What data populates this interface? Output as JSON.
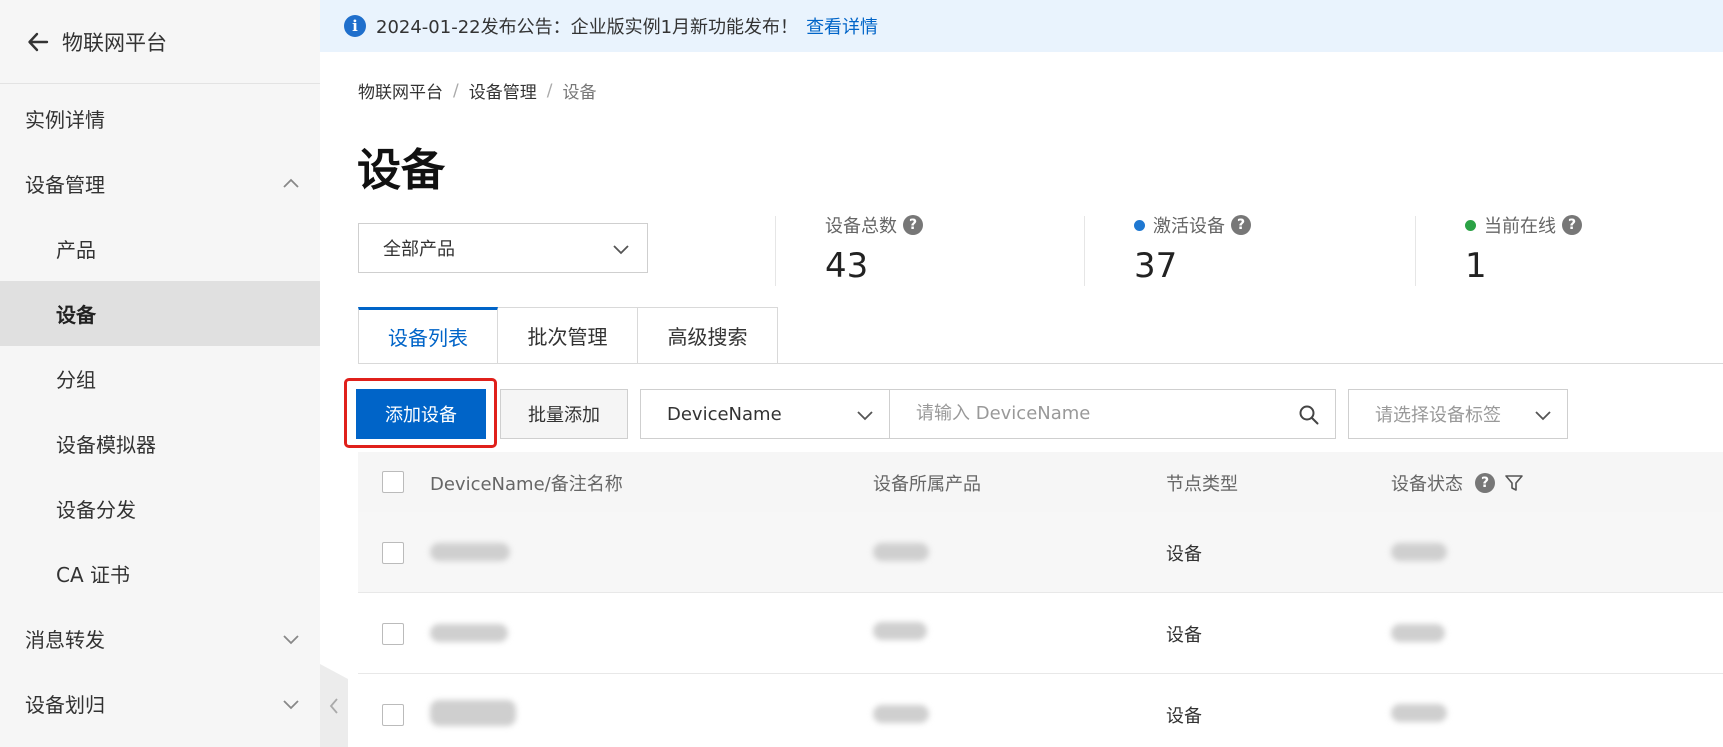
{
  "sidebar": {
    "title": "物联网平台",
    "items": [
      {
        "label": "实例详情"
      },
      {
        "label": "设备管理"
      },
      {
        "label": "产品"
      },
      {
        "label": "设备"
      },
      {
        "label": "分组"
      },
      {
        "label": "设备模拟器"
      },
      {
        "label": "设备分发"
      },
      {
        "label": "CA 证书"
      },
      {
        "label": "消息转发"
      },
      {
        "label": "设备划归"
      }
    ]
  },
  "notice": {
    "text": "2024-01-22发布公告：企业版实例1月新功能发布！",
    "link": "查看详情"
  },
  "breadcrumb": [
    "物联网平台",
    "设备管理",
    "设备"
  ],
  "page_title": "设备",
  "product_select": {
    "value": "全部产品"
  },
  "stats": {
    "total": {
      "label": "设备总数",
      "value": "43"
    },
    "active": {
      "label": "激活设备",
      "value": "37",
      "dot_color": "#1f78d1"
    },
    "online": {
      "label": "当前在线",
      "value": "1",
      "dot_color": "#2ba245"
    }
  },
  "tabs": [
    "设备列表",
    "批次管理",
    "高级搜索"
  ],
  "toolbar": {
    "add_label": "添加设备",
    "batch_label": "批量添加",
    "field_value": "DeviceName",
    "search_placeholder": "请输入 DeviceName",
    "tag_placeholder": "请选择设备标签"
  },
  "table": {
    "headers": [
      "DeviceName/备注名称",
      "设备所属产品",
      "节点类型",
      "设备状态"
    ],
    "rows": [
      {
        "node_type": "设备"
      },
      {
        "node_type": "设备"
      },
      {
        "node_type": "设备"
      }
    ]
  },
  "colors": {
    "accent": "#0064c8",
    "highlight": "#e0201b",
    "notice_bg": "#e9f3fd"
  }
}
